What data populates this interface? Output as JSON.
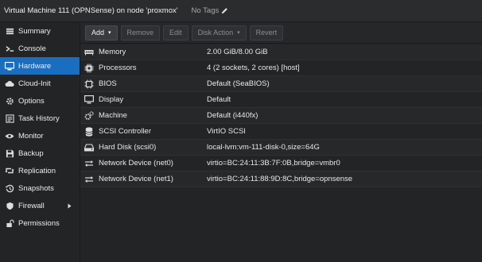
{
  "header": {
    "title": "Virtual Machine 111 (OPNSense) on node 'proxmox'",
    "tags": "No Tags"
  },
  "sidebar": {
    "items": [
      {
        "label": "Summary",
        "icon": "summary-icon"
      },
      {
        "label": "Console",
        "icon": "console-icon"
      },
      {
        "label": "Hardware",
        "icon": "hardware-icon",
        "active": true
      },
      {
        "label": "Cloud-Init",
        "icon": "cloud-icon"
      },
      {
        "label": "Options",
        "icon": "gear-icon"
      },
      {
        "label": "Task History",
        "icon": "list-icon"
      },
      {
        "label": "Monitor",
        "icon": "eye-icon"
      },
      {
        "label": "Backup",
        "icon": "floppy-icon"
      },
      {
        "label": "Replication",
        "icon": "retweet-icon"
      },
      {
        "label": "Snapshots",
        "icon": "history-icon"
      },
      {
        "label": "Firewall",
        "icon": "shield-icon"
      },
      {
        "label": "Permissions",
        "icon": "unlock-icon"
      }
    ]
  },
  "toolbar": {
    "add_label": "Add",
    "remove_label": "Remove",
    "edit_label": "Edit",
    "disk_action_label": "Disk Action",
    "revert_label": "Revert"
  },
  "hardware": [
    {
      "name": "Memory",
      "value": "2.00 GiB/8.00 GiB",
      "icon": "memory-icon"
    },
    {
      "name": "Processors",
      "value": "4 (2 sockets, 2 cores) [host]",
      "icon": "cpu-icon"
    },
    {
      "name": "BIOS",
      "value": "Default (SeaBIOS)",
      "icon": "chip-icon"
    },
    {
      "name": "Display",
      "value": "Default",
      "icon": "monitor-icon"
    },
    {
      "name": "Machine",
      "value": "Default (i440fx)",
      "icon": "cogs-icon"
    },
    {
      "name": "SCSI Controller",
      "value": "VirtIO SCSI",
      "icon": "database-icon"
    },
    {
      "name": "Hard Disk (scsi0)",
      "value": "local-lvm:vm-111-disk-0,size=64G",
      "icon": "harddisk-icon"
    },
    {
      "name": "Network Device (net0)",
      "value": "virtio=BC:24:11:3B:7F:0B,bridge=vmbr0",
      "icon": "network-icon"
    },
    {
      "name": "Network Device (net1)",
      "value": "virtio=BC:24:11:88:9D:8C,bridge=opnsense",
      "icon": "network-icon"
    }
  ],
  "colors": {
    "accent": "#1a6ec0",
    "background": "#232426"
  }
}
